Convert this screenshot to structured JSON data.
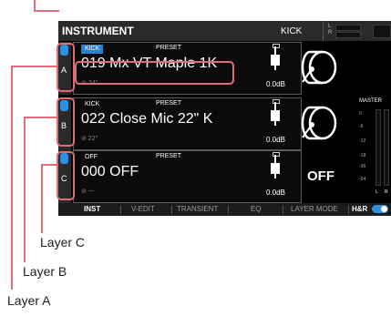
{
  "header": {
    "title": "INSTRUMENT",
    "kit": "KICK",
    "lr": [
      "L",
      "R"
    ]
  },
  "layers": [
    {
      "letter": "A",
      "inst": "KICK",
      "preset_label": "PRESET",
      "name": "019 Mx VT Maple 1K",
      "tune": "⊘ 24\"",
      "level": "0.0dB",
      "instrument_icon": "kick-drum-icon",
      "selected": true
    },
    {
      "letter": "B",
      "inst": "KICK",
      "preset_label": "PRESET",
      "name": "022 Close Mic 22\" K",
      "tune": "⊘ 22\"",
      "level": "0.0dB",
      "instrument_icon": "kick-drum-icon",
      "selected": false
    },
    {
      "letter": "C",
      "inst": "OFF",
      "preset_label": "PRESET",
      "name": "000 OFF",
      "tune": "⊘ ---",
      "level": "0.0dB",
      "off_label": "OFF",
      "selected": false
    }
  ],
  "master": {
    "label": "MASTER",
    "ticks": [
      "0",
      "-6",
      "-12",
      "-18",
      "-36",
      "-54"
    ],
    "lr": [
      "L",
      "R"
    ]
  },
  "tabs": [
    "INST",
    "V-EDIT",
    "TRANSIENT",
    "EQ",
    "LAYER MODE",
    "H&R"
  ],
  "callouts": {
    "a": "Layer A",
    "b": "Layer B",
    "c": "Layer C"
  },
  "colors": {
    "accent": "#2f8fe0",
    "highlight": "#e06c7a",
    "screen_bg": "#000000"
  }
}
